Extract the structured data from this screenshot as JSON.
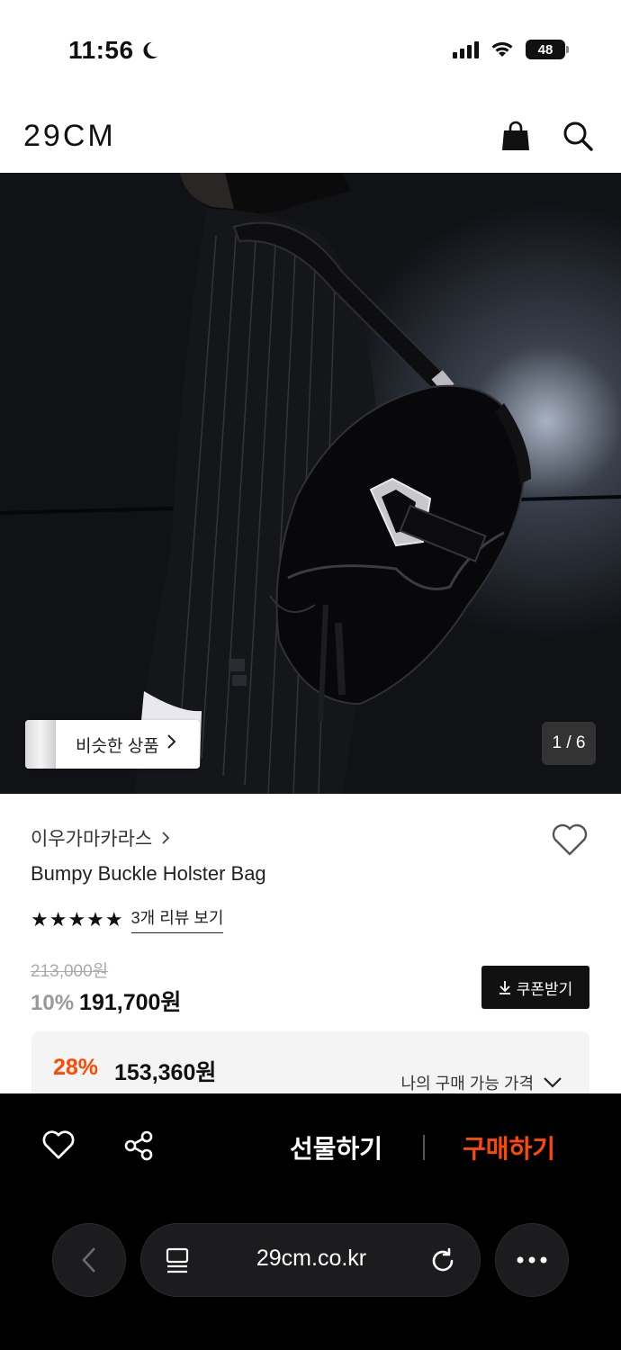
{
  "status_bar": {
    "time": "11:56",
    "battery": "48",
    "icons": [
      "moon-icon",
      "signal-icon",
      "wifi-icon",
      "battery-icon"
    ]
  },
  "header": {
    "logo": "29CM",
    "icons": [
      "shopping-bag-icon",
      "search-icon"
    ]
  },
  "hero": {
    "similar_label": "비슷한 상품",
    "counter": "1 / 6"
  },
  "product": {
    "brand": "이우가마카라스",
    "name": "Bumpy Buckle Holster Bag",
    "stars": "★★★★★",
    "review_link": "3개 리뷰 보기",
    "original_price": "213,000원",
    "discount_rate": "10%",
    "sale_price": "191,700원",
    "coupon_label": "쿠폰받기"
  },
  "my_price": {
    "rate": "28%",
    "price": "153,360원",
    "label": "나의 구매 가능 가격"
  },
  "bottom_bar": {
    "gift_label": "선물하기",
    "buy_label": "구매하기"
  },
  "browser": {
    "url": "29cm.co.kr"
  },
  "colors": {
    "accent": "#ff4800",
    "dark": "#111111"
  }
}
